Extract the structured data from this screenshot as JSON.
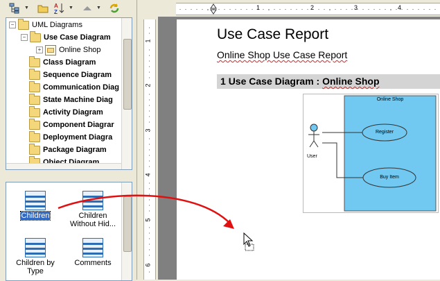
{
  "toolbar": {
    "buttons": [
      "structure-icon",
      "open-folder-icon",
      "sort-az-icon",
      "collapse-up-icon",
      "refresh-icon"
    ]
  },
  "tree": {
    "root": "UML Diagrams",
    "items": [
      {
        "label": "Use Case Diagram",
        "bold": true
      },
      {
        "label": "Online Shop",
        "bold": false
      },
      {
        "label": "Class Diagram",
        "bold": true
      },
      {
        "label": "Sequence Diagram",
        "bold": true
      },
      {
        "label": "Communication Diag",
        "bold": true
      },
      {
        "label": "State Machine Diag",
        "bold": true
      },
      {
        "label": "Activity Diagram",
        "bold": true
      },
      {
        "label": "Component Diagrar",
        "bold": true
      },
      {
        "label": "Deployment Diagra",
        "bold": true
      },
      {
        "label": "Package Diagram",
        "bold": true
      },
      {
        "label": "Object Diagram",
        "bold": true
      }
    ]
  },
  "templates": [
    {
      "label": "Children",
      "selected": true
    },
    {
      "label": "Children Without Hid...",
      "selected": false
    },
    {
      "label": "Children by Type",
      "selected": false
    },
    {
      "label": "Comments",
      "selected": false
    }
  ],
  "report": {
    "title": "Use Case Report",
    "subtitle": "Online Shop Use Case Report",
    "section_num": "1",
    "section_prefix": "Use Case Diagram :",
    "section_name": "Online Shop"
  },
  "diagram": {
    "system": "Online Shop",
    "actor": "User",
    "usecases": [
      "Register",
      "Buy Item"
    ]
  },
  "ruler": {
    "h_numbers": [
      "1",
      "2",
      "3",
      "4"
    ],
    "v_numbers": [
      "1",
      "2",
      "3",
      "4",
      "5",
      "6"
    ]
  },
  "colors": {
    "arrow": "#e01010",
    "system_fill": "#71c8f0",
    "selection": "#316ac5"
  }
}
